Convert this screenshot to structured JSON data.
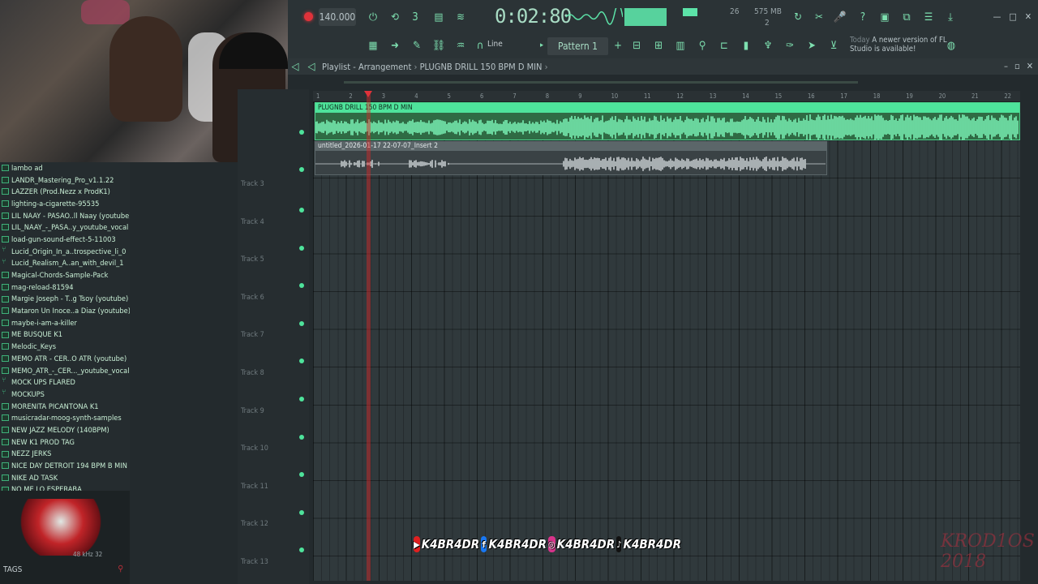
{
  "toolbar": {
    "tempo": "140.000",
    "time": "0:02:80",
    "cpu": "26",
    "ram": "575 MB",
    "ram2": "2",
    "line_mode": "Line",
    "pattern": "Pattern 1",
    "news_today": "Today",
    "news_text": "A newer version of FL Studio is available!"
  },
  "playlist": {
    "title": "Playlist - Arrangement",
    "project": "PLUGNB DRILL 150 BPM D MIN",
    "ruler": [
      "1",
      "2",
      "3",
      "4",
      "5",
      "6",
      "7",
      "8",
      "9",
      "10",
      "11",
      "12",
      "13",
      "14",
      "15",
      "16",
      "17",
      "18",
      "19",
      "20",
      "21",
      "22"
    ],
    "clips": [
      {
        "name": "PLUGNB DRILL 150 BPM D MIN"
      },
      {
        "name": "untitled_2026-01-17 22-07-07_Insert 2"
      }
    ],
    "tracks": [
      "Track 3",
      "Track 4",
      "Track 5",
      "Track 6",
      "Track 7",
      "Track 8",
      "Track 9",
      "Track 10",
      "Track 11",
      "Track 12",
      "Track 13"
    ]
  },
  "browser": {
    "items": [
      {
        "label": "lambo ad",
        "type": "file"
      },
      {
        "label": "LANDR_Mastering_Pro_v1.1.22",
        "type": "file"
      },
      {
        "label": "LAZZER (Prod.Nezz x ProdK1)",
        "type": "file"
      },
      {
        "label": "lighting-a-cigarette-95535",
        "type": "file"
      },
      {
        "label": "LIL NAAY - PASAO..ll Naay (youtube)",
        "type": "file"
      },
      {
        "label": "LIL_NAAY_-_PASA..y_youtube_vocal",
        "type": "file"
      },
      {
        "label": "load-gun-sound-effect-5-11003",
        "type": "file"
      },
      {
        "label": "Lucid_Origin_In_a..trospective_li_0",
        "type": "folder"
      },
      {
        "label": "Lucid_Realism_A..an_with_devil_1",
        "type": "folder"
      },
      {
        "label": "Magical-Chords-Sample-Pack",
        "type": "file"
      },
      {
        "label": "mag-reload-81594",
        "type": "file"
      },
      {
        "label": "Margie Joseph - T..g Tsoy (youtube)",
        "type": "file"
      },
      {
        "label": "Mataron Un Inoce..a Diaz (youtube)",
        "type": "file"
      },
      {
        "label": "maybe-i-am-a-killer",
        "type": "file"
      },
      {
        "label": "ME BUSQUE K1",
        "type": "file"
      },
      {
        "label": "Melodic_Keys",
        "type": "file"
      },
      {
        "label": "MEMO ATR - CER..O ATR (youtube)",
        "type": "file"
      },
      {
        "label": "MEMO_ATR_-_CER..._youtube_vocal",
        "type": "file"
      },
      {
        "label": "MOCK UPS FLARED",
        "type": "folder"
      },
      {
        "label": "MOCKUPS",
        "type": "folder"
      },
      {
        "label": "MORENITA PICANTONA K1",
        "type": "file"
      },
      {
        "label": "musicradar-moog-synth-samples",
        "type": "file"
      },
      {
        "label": "NEW JAZZ MELODY (140BPM)",
        "type": "file"
      },
      {
        "label": "NEW K1 PROD TAG",
        "type": "file"
      },
      {
        "label": "NEZZ JERKS",
        "type": "file"
      },
      {
        "label": "NICE DAY DETROIT 194 BPM B MIN",
        "type": "file"
      },
      {
        "label": "NIKE AD TASK",
        "type": "file"
      },
      {
        "label": "NO ME LO ESPERABA",
        "type": "file"
      }
    ],
    "tags_label": "TAGS",
    "sample_rate": "48 kHz 32"
  },
  "overlay": {
    "handle1": "K4BR4DR",
    "handle2": "K4BR4DR",
    "handle3": "K4BR4DR",
    "handle4": "K4BR4DR",
    "signature": "KROD1OS 2018",
    "colors": {
      "youtube": "#e02020",
      "facebook": "#1877f2",
      "instagram": "#d6338a",
      "tiktok": "#111111"
    }
  },
  "colors": {
    "accent": "#4ee39b",
    "record": "#e0323a",
    "playhead": "#e0323a"
  }
}
